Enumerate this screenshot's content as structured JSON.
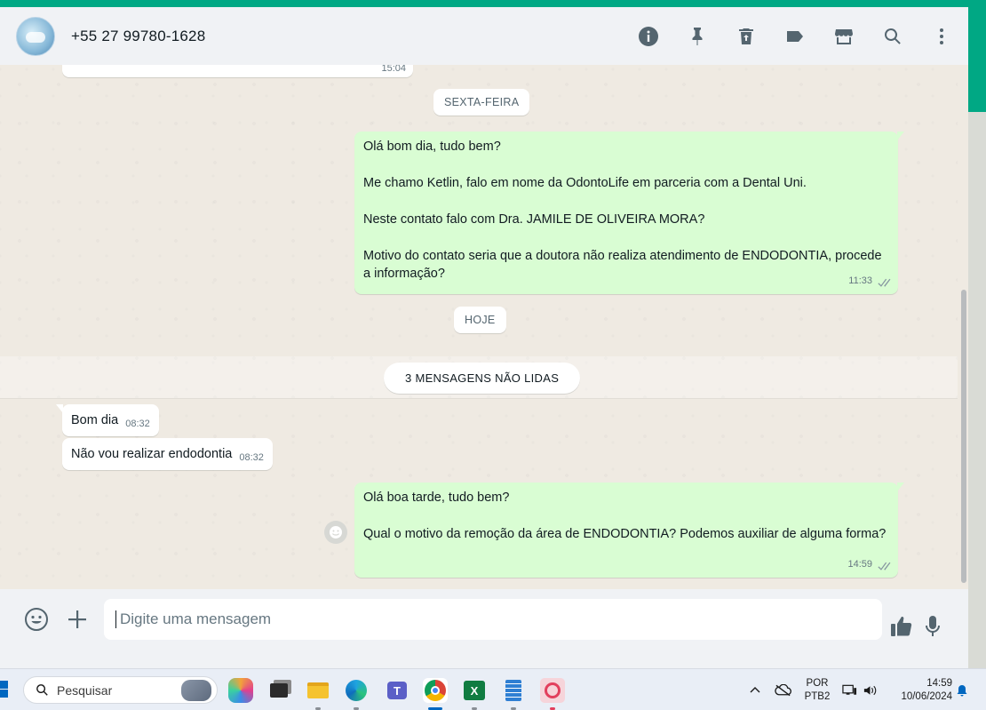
{
  "header": {
    "contact_name": "+55 27 99780-1628",
    "icons": [
      "info-icon",
      "pin-icon",
      "delete-icon",
      "label-icon",
      "store-icon",
      "search-icon",
      "menu-icon"
    ]
  },
  "chat": {
    "partial_message_time": "15:04",
    "day_friday": "SEXTA-FEIRA",
    "outgoing_1": {
      "lines": [
        "Olá bom dia, tudo bem?",
        "Me chamo Ketlin, falo em nome da OdontoLife em parceria com a Dental Uni.",
        "Neste contato falo com Dra. JAMILE DE OLIVEIRA MORA?",
        "Motivo do contato seria que a doutora não realiza atendimento de ENDODONTIA, procede a informação?"
      ],
      "time": "11:33"
    },
    "day_today": "HOJE",
    "unread_label": "3 MENSAGENS NÃO LIDAS",
    "incoming": [
      {
        "text": "Bom dia",
        "time": "08:32"
      },
      {
        "text": "Não vou realizar endodontia",
        "time": "08:32"
      }
    ],
    "outgoing_2": {
      "lines": [
        "Olá boa tarde, tudo bem?",
        "Qual o motivo da remoção da área de ENDODONTIA? Podemos auxiliar de alguma forma?"
      ],
      "time": "14:59"
    }
  },
  "composer": {
    "placeholder": "Digite uma mensagem"
  },
  "taskbar": {
    "search_placeholder": "Pesquisar",
    "language_top": "POR",
    "language_bottom": "PTB2",
    "time": "14:59",
    "date": "10/06/2024"
  },
  "colors": {
    "accent": "#00a884",
    "outgoing_bubble": "#d9fdd3",
    "incoming_bubble": "#ffffff",
    "chat_background": "#efeae2"
  }
}
